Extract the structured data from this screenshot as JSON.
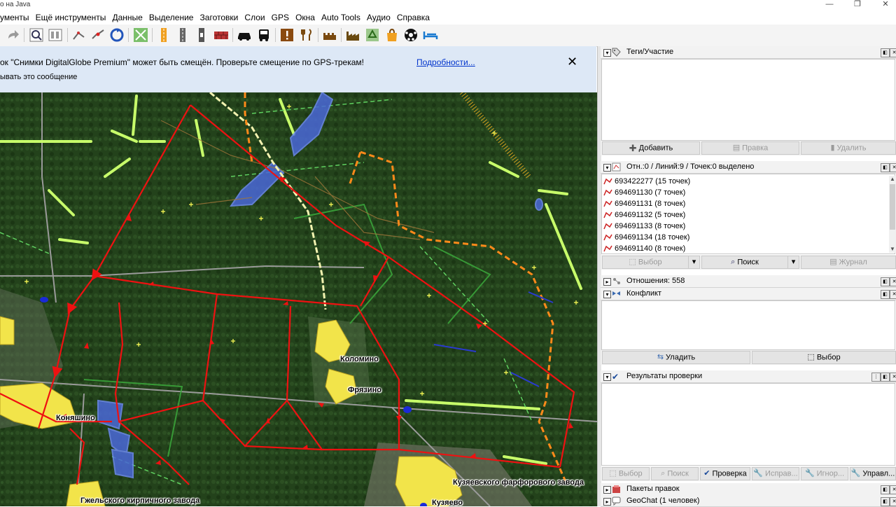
{
  "window": {
    "title": "о на Java"
  },
  "menu": [
    "ументы",
    "Ещё инструменты",
    "Данные",
    "Выделение",
    "Заготовки",
    "Слои",
    "GPS",
    "Окна",
    "Auto Tools",
    "Аудио",
    "Справка"
  ],
  "notification": {
    "message": "ок \"Снимки DigitalGlobe Premium\" может быть смещён. Проверьте смещение по GPS-трекам!",
    "dismiss": "ывать это сообщение",
    "details_link": "Подробности...",
    "close": "✕"
  },
  "map": {
    "places": [
      "Коломино",
      "Фрязино",
      "Коняшино",
      "Кузяевского фарфорового завода",
      "Гжельского кирпичного завода",
      "Кузяево"
    ]
  },
  "panels": {
    "tags": {
      "title": "Теги/Участие",
      "buttons": {
        "add": "Добавить",
        "edit": "Правка",
        "delete": "Удалить"
      }
    },
    "selection": {
      "title": "Отн.:0 / Линий:9 / Точек:0 выделено",
      "items": [
        "693422277 (15 точек)",
        "694691130 (7 точек)",
        "694691131 (8 точек)",
        "694691132 (5 точек)",
        "694691133 (8 точек)",
        "694691134 (18 точек)",
        "694691140 (8 точек)"
      ],
      "buttons": {
        "select": "Выбор",
        "search": "Поиск",
        "history": "Журнал"
      }
    },
    "relations": {
      "title": "Отношения: 558"
    },
    "conflict": {
      "title": "Конфликт",
      "buttons": {
        "resolve": "Уладить",
        "select": "Выбор"
      }
    },
    "validation": {
      "title": "Результаты проверки",
      "buttons": {
        "select": "Выбор",
        "search": "Поиск",
        "validate": "Проверка",
        "fix": "Исправ...",
        "ignore": "Игнор...",
        "manage": "Управл..."
      }
    },
    "changesets": {
      "title": "Пакеты правок"
    },
    "geochat": {
      "title": "GeoChat (1 человек)"
    }
  },
  "colors": {
    "route": "#ee1111",
    "highway": "#ccff66",
    "water": "#4466dd",
    "town": "#f0e040",
    "forest": "#23421b"
  }
}
